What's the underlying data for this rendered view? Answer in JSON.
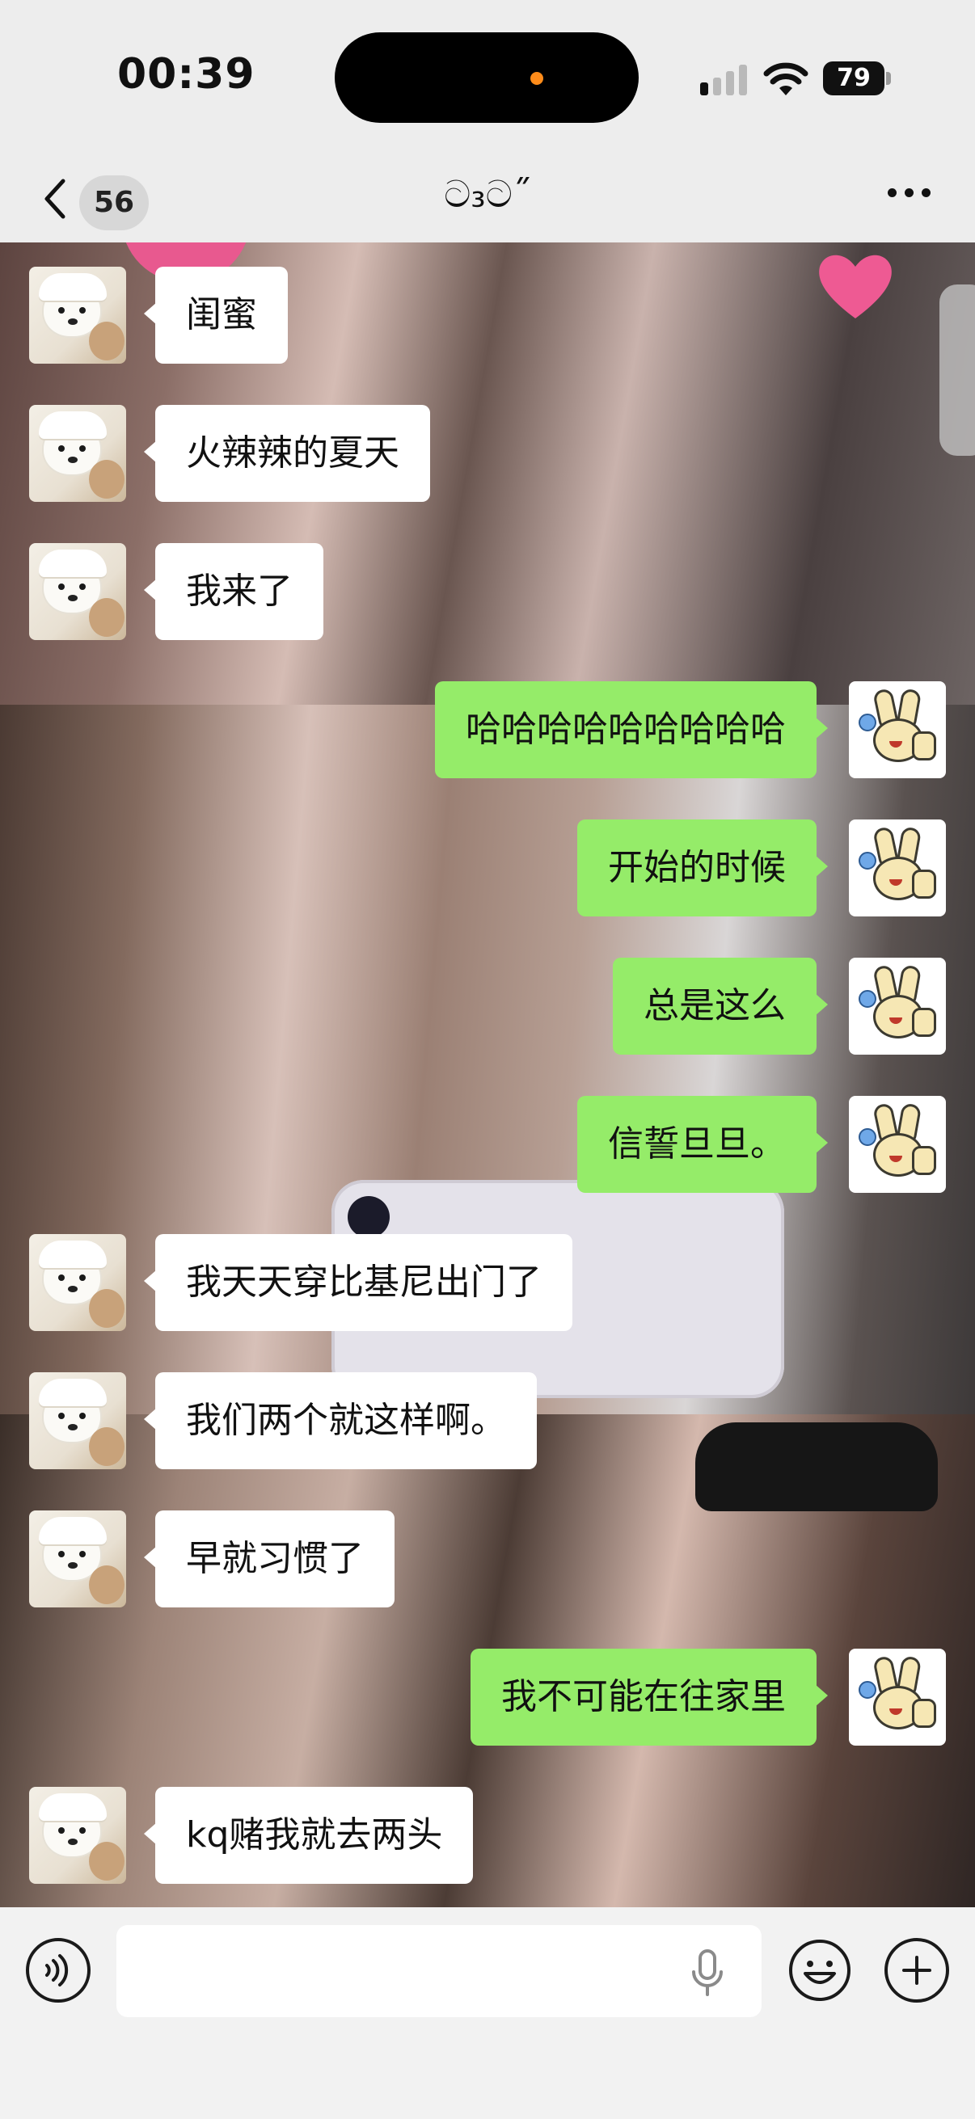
{
  "status_bar": {
    "time": "00:39",
    "battery": "79"
  },
  "nav": {
    "unread_count": "56",
    "title": "ට₃ට˝"
  },
  "colors": {
    "self_bubble": "#95ec69",
    "other_bubble": "#ffffff",
    "dynamic_island_dot": "#ff8c1a"
  },
  "messages": [
    {
      "side": "left",
      "sender": "friend",
      "text": "闺蜜"
    },
    {
      "side": "left",
      "sender": "friend",
      "text": "火辣辣的夏天"
    },
    {
      "side": "left",
      "sender": "friend",
      "text": "我来了"
    },
    {
      "side": "right",
      "sender": "me",
      "text": "哈哈哈哈哈哈哈哈哈"
    },
    {
      "side": "right",
      "sender": "me",
      "text": "开始的时候"
    },
    {
      "side": "right",
      "sender": "me",
      "text": "总是这么"
    },
    {
      "side": "right",
      "sender": "me",
      "text": "信誓旦旦。"
    },
    {
      "side": "left",
      "sender": "friend",
      "text": "我天天穿比基尼出门了"
    },
    {
      "side": "left",
      "sender": "friend",
      "text": "我们两个就这样啊。"
    },
    {
      "side": "left",
      "sender": "friend",
      "text": "早就习惯了"
    },
    {
      "side": "right",
      "sender": "me",
      "text": "我不可能在往家里"
    },
    {
      "side": "left",
      "sender": "friend",
      "text": "kq赌我就去两头"
    }
  ],
  "input": {
    "value": "",
    "placeholder": ""
  },
  "icons": {
    "back": "chevron-left-icon",
    "more": "ellipsis-icon",
    "voice": "voice-icon",
    "mic": "microphone-icon",
    "emoji": "smiley-icon",
    "plus": "plus-icon"
  }
}
